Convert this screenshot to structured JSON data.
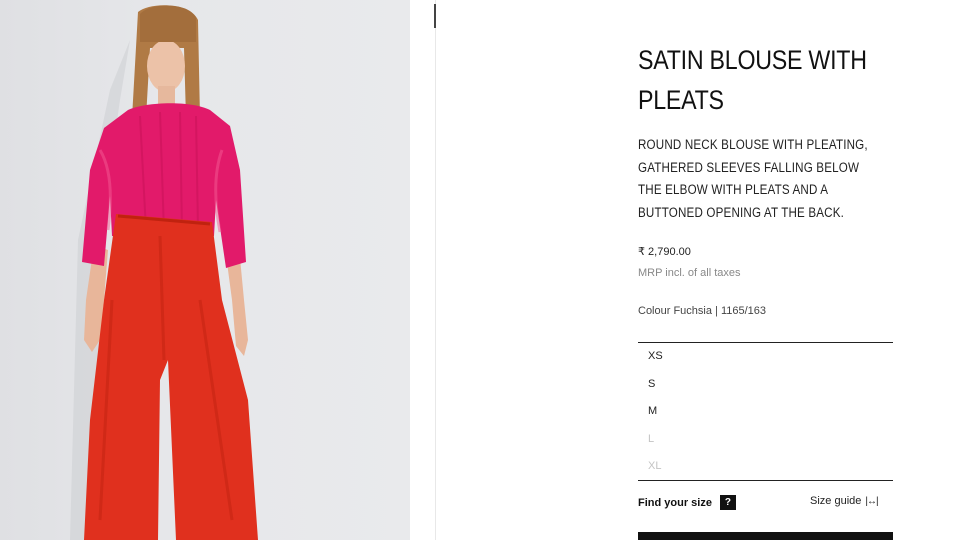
{
  "product": {
    "title_line1": "SATIN BLOUSE WITH",
    "title_line2": "PLEATS",
    "description_lines": [
      "ROUND NECK BLOUSE WITH PLEATING,",
      "GATHERED SLEEVES FALLING BELOW",
      "THE ELBOW WITH PLEATS AND A",
      "BUTTONED OPENING AT THE BACK."
    ],
    "price": "₹ 2,790.00",
    "tax_note": "MRP incl. of all taxes",
    "colour_info": "Colour Fuchsia | 1165/163"
  },
  "sizes": [
    {
      "label": "XS",
      "available": true
    },
    {
      "label": "S",
      "available": true
    },
    {
      "label": "M",
      "available": true
    },
    {
      "label": "L",
      "available": false
    },
    {
      "label": "XL",
      "available": false
    }
  ],
  "size_help": {
    "find_label": "Find your size",
    "find_icon_glyph": "?",
    "guide_label": "Size guide",
    "guide_icon": "|↔|"
  },
  "colors": {
    "blouse": "#e21a6a",
    "trousers": "#e0301e",
    "background": "#e4e5e8"
  }
}
